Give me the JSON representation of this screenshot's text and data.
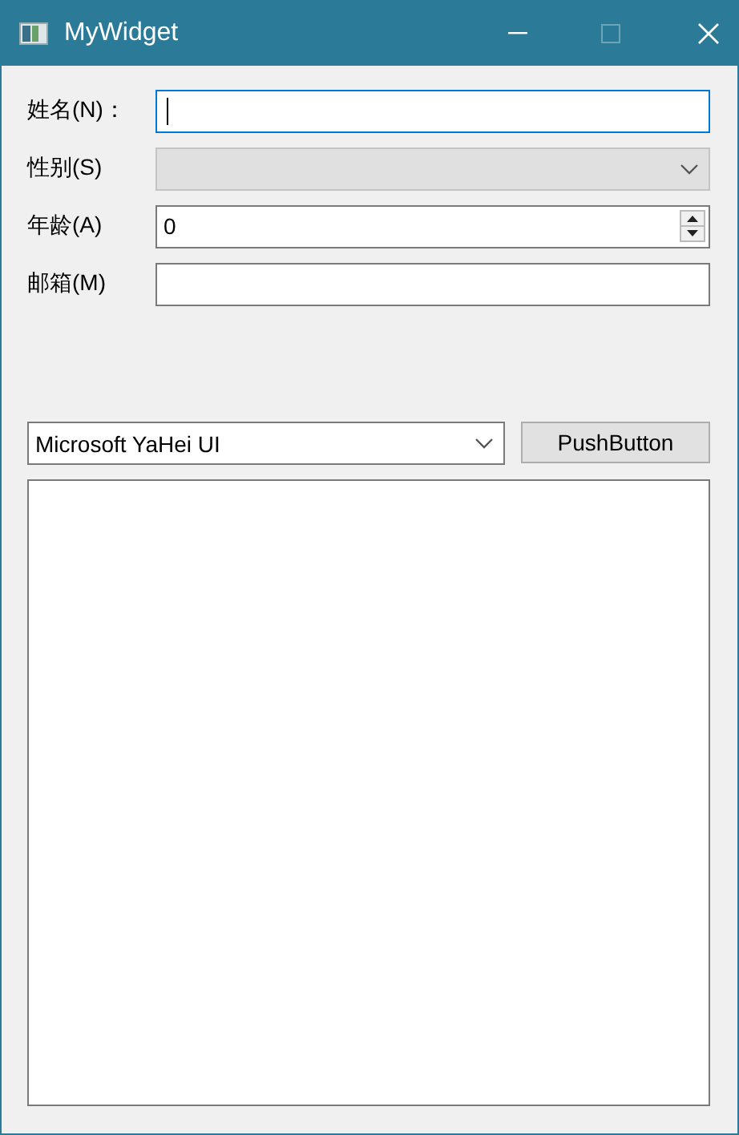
{
  "window": {
    "title": "MyWidget"
  },
  "form": [
    {
      "kind": "text",
      "label": "姓名(N)：",
      "focused": true,
      "disabled": false
    },
    {
      "kind": "combo",
      "label": "性别(S)",
      "focused": false,
      "disabled": true
    },
    {
      "kind": "spin",
      "label": "年龄(A)",
      "value": "0",
      "focused": false,
      "disabled": false
    },
    {
      "kind": "text",
      "label": "邮箱(M)",
      "focused": false,
      "disabled": false
    }
  ],
  "font_combo": {
    "value": "Microsoft YaHei UI"
  },
  "push_button": {
    "label": "PushButton"
  }
}
